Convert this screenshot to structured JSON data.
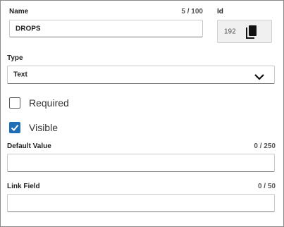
{
  "name_field": {
    "label": "Name",
    "counter": "5 / 100",
    "value": "DROPS"
  },
  "id_field": {
    "label": "Id",
    "value": "192",
    "copy_icon": "copy-icon"
  },
  "type_field": {
    "label": "Type",
    "selected": "Text",
    "icon": "chevron-down-icon"
  },
  "checkboxes": {
    "required": {
      "label": "Required",
      "checked": false
    },
    "visible": {
      "label": "Visible",
      "checked": true
    }
  },
  "default_value": {
    "label": "Default Value",
    "counter": "0 / 250",
    "value": ""
  },
  "link_field": {
    "label": "Link Field",
    "counter": "0 / 50",
    "value": ""
  },
  "colors": {
    "accent": "#1e6fb8",
    "border": "#8a8a8a"
  }
}
